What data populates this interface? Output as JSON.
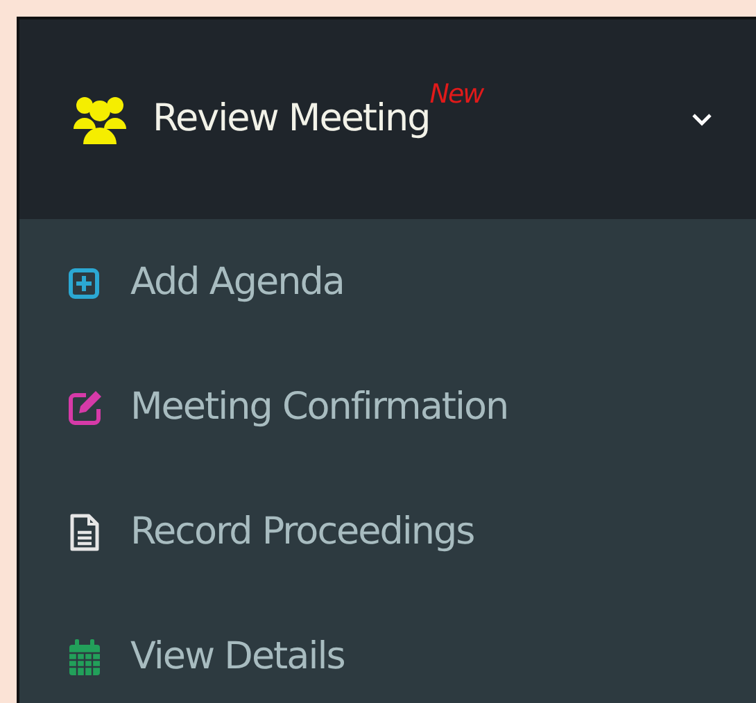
{
  "menu": {
    "title": "Review Meeting",
    "badge": "New",
    "expanded": true,
    "items": [
      {
        "label": "Add Agenda",
        "kind": "add",
        "color": "#2ba8d3"
      },
      {
        "label": "Meeting Confirmation",
        "kind": "edit",
        "color": "#d63aa8"
      },
      {
        "label": "Record Proceedings",
        "kind": "document",
        "color": "#e6e6e6"
      },
      {
        "label": "View Details",
        "kind": "calendar",
        "color": "#22a05a"
      }
    ]
  }
}
